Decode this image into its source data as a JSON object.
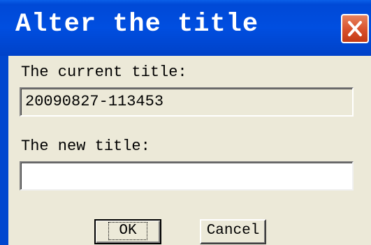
{
  "window": {
    "title": "Alter the title",
    "close_icon": "close-icon"
  },
  "dialog": {
    "current_title_label": "The current title:",
    "current_title_value": "20090827-113453",
    "new_title_label": "The new title:",
    "new_title_value": "",
    "new_title_placeholder": ""
  },
  "buttons": {
    "ok_label": "OK",
    "cancel_label": "Cancel"
  },
  "colors": {
    "titlebar": "#0049d6",
    "face": "#ece9d8",
    "close_button": "#d8502b"
  }
}
